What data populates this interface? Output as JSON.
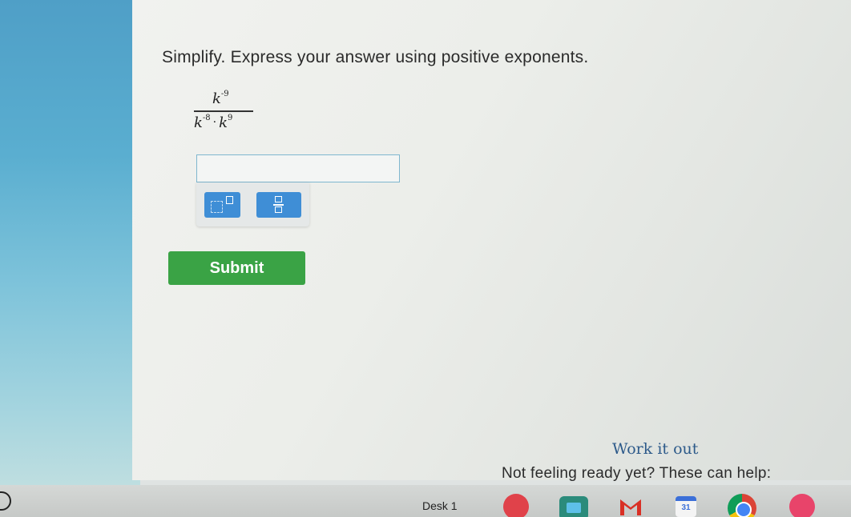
{
  "question": {
    "instruction": "Simplify. Express your answer using positive exponents.",
    "numerator_base": "k",
    "numerator_exponent": "-9",
    "denominator_base_1": "k",
    "denominator_exponent_1": "-8",
    "denominator_operator": "·",
    "denominator_base_2": "k",
    "denominator_exponent_2": "9"
  },
  "answer_field": {
    "value": "",
    "placeholder": ""
  },
  "tools": {
    "exponent_tool": "exponent-template",
    "fraction_tool": "fraction-template"
  },
  "submit": {
    "label": "Submit",
    "color": "#3aa345"
  },
  "help": {
    "work_it_out": "Work it out",
    "not_ready": "Not feeling ready yet? These can help:"
  },
  "taskbar": {
    "desk_label": "Desk 1",
    "calendar_day": "31",
    "apps": [
      "launcher-icon",
      "photos-icon",
      "files-icon",
      "gmail-icon",
      "calendar-icon",
      "chrome-icon",
      "app-icon"
    ]
  }
}
